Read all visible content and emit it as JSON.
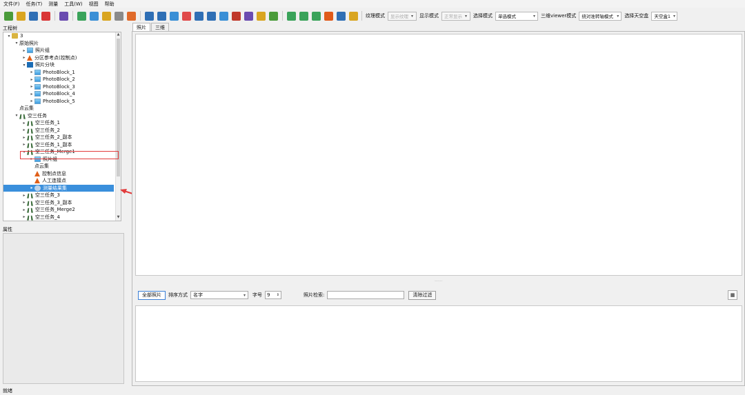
{
  "menu": [
    "文件(F)",
    "任务(T)",
    "测量",
    "工具(W)",
    "视图",
    "帮助"
  ],
  "toolbar": {
    "icons": [
      {
        "name": "new-file-icon",
        "color": "#4a9b3a"
      },
      {
        "name": "open-folder-icon",
        "color": "#d9a520"
      },
      {
        "name": "save-icon",
        "color": "#2f6fb5"
      },
      {
        "name": "close-icon",
        "color": "#d93535"
      },
      {
        "name": "grid-icon",
        "color": "#6a4bb0"
      },
      {
        "name": "dot-icon",
        "color": "#3aa35a"
      },
      {
        "name": "ruler-icon",
        "color": "#3a8fd6"
      },
      {
        "name": "area-icon",
        "color": "#d9a520"
      },
      {
        "name": "cube-icon",
        "color": "#8a8a8a"
      },
      {
        "name": "eraser-icon",
        "color": "#e06a2a"
      },
      {
        "name": "gear-icon",
        "color": "#2f6fb5"
      },
      {
        "name": "text-icon",
        "color": "#2f6fb5"
      },
      {
        "name": "image-icon",
        "color": "#3a8fd6"
      },
      {
        "name": "images-icon",
        "color": "#e04a4a"
      },
      {
        "name": "camera-icon",
        "color": "#2f6fb5"
      },
      {
        "name": "export-icon",
        "color": "#2f6fb5"
      },
      {
        "name": "layer-icon",
        "color": "#3a8fd6"
      },
      {
        "name": "palette-icon",
        "color": "#c0392b"
      },
      {
        "name": "crop-icon",
        "color": "#6a4bb0"
      },
      {
        "name": "scissors-icon",
        "color": "#d9a520"
      },
      {
        "name": "triangle-icon",
        "color": "#4a9b3a"
      },
      {
        "name": "camera-plus-icon",
        "color": "#3aa35a"
      },
      {
        "name": "camera-check-icon",
        "color": "#3aa35a"
      },
      {
        "name": "check-icon",
        "color": "#3aa35a"
      },
      {
        "name": "warning-icon",
        "color": "#e05a1a"
      },
      {
        "name": "points-icon",
        "color": "#2f6fb5"
      },
      {
        "name": "brush-icon",
        "color": "#d9a520"
      }
    ],
    "texture_mode_label": "纹理模式",
    "texture_mode_value": "显示纹理",
    "display_mode_label": "显示模式",
    "display_mode_value": "正常显示",
    "select_mode_label": "选择模式",
    "select_mode_value": "单选模式",
    "view3d_mode_label": "三维viewer模式",
    "view3d_mode_value": "绕对准转轴模式",
    "sky_box_label": "选择天空盒",
    "sky_box_value": "天空盒1"
  },
  "project_tree": {
    "title": "工程树",
    "rows": [
      {
        "indent": 0,
        "twisty": "▾",
        "icon": "folder",
        "label": "3"
      },
      {
        "indent": 1,
        "twisty": "▾",
        "icon": "",
        "label": "原始照片"
      },
      {
        "indent": 2,
        "twisty": "▸",
        "icon": "photo",
        "label": "照片组"
      },
      {
        "indent": 2,
        "twisty": "▸",
        "icon": "warn",
        "label": "分区参考点(控制点)"
      },
      {
        "indent": 2,
        "twisty": "▾",
        "icon": "block",
        "label": "照片分块"
      },
      {
        "indent": 3,
        "twisty": "▸",
        "icon": "photo",
        "label": "PhotoBlock_1"
      },
      {
        "indent": 3,
        "twisty": "▸",
        "icon": "photo",
        "label": "PhotoBlock_2"
      },
      {
        "indent": 3,
        "twisty": "▸",
        "icon": "photo",
        "label": "PhotoBlock_3"
      },
      {
        "indent": 3,
        "twisty": "▸",
        "icon": "photo",
        "label": "PhotoBlock_4"
      },
      {
        "indent": 3,
        "twisty": "▸",
        "icon": "photo",
        "label": "PhotoBlock_5"
      },
      {
        "indent": 1,
        "twisty": "",
        "icon": "",
        "label": "点云集"
      },
      {
        "indent": 1,
        "twisty": "▾",
        "icon": "task",
        "label": "空三任务"
      },
      {
        "indent": 2,
        "twisty": "▸",
        "icon": "task",
        "label": "空三任务_1"
      },
      {
        "indent": 2,
        "twisty": "▸",
        "icon": "task",
        "label": "空三任务_2"
      },
      {
        "indent": 2,
        "twisty": "▸",
        "icon": "task",
        "label": "空三任务_2_副本"
      },
      {
        "indent": 2,
        "twisty": "▸",
        "icon": "task",
        "label": "空三任务_1_副本"
      },
      {
        "indent": 2,
        "twisty": "▾",
        "icon": "task",
        "label": "空三任务_Merge1"
      },
      {
        "indent": 3,
        "twisty": "▸",
        "icon": "photo",
        "label": "照片组"
      },
      {
        "indent": 3,
        "twisty": "",
        "icon": "",
        "label": "点云集"
      },
      {
        "indent": 3,
        "twisty": "",
        "icon": "warn",
        "label": "控制点信息"
      },
      {
        "indent": 3,
        "twisty": "",
        "icon": "warn",
        "label": "人工连接点"
      },
      {
        "indent": 3,
        "twisty": "▸",
        "icon": "cloud",
        "label": "测量结果集",
        "selected": true
      },
      {
        "indent": 2,
        "twisty": "▸",
        "icon": "task",
        "label": "空三任务_3"
      },
      {
        "indent": 2,
        "twisty": "▸",
        "icon": "task",
        "label": "空三任务_3_副本"
      },
      {
        "indent": 2,
        "twisty": "▸",
        "icon": "task",
        "label": "空三任务_Merge2"
      },
      {
        "indent": 2,
        "twisty": "▸",
        "icon": "task",
        "label": "空三任务_4"
      }
    ]
  },
  "properties": {
    "title": "属性"
  },
  "tabs": [
    "照片",
    "三维"
  ],
  "filter": {
    "all_photos": "全部照片",
    "sort_label": "排序方式",
    "sort_value": "名字",
    "font_size_label": "字号",
    "font_size_value": "9",
    "search_label": "照片检索:",
    "search_value": "",
    "clear_label": "清除过滤"
  },
  "status": "就绪",
  "colors": {
    "selection": "#3a8fdc",
    "highlight": "#e23b3b"
  }
}
